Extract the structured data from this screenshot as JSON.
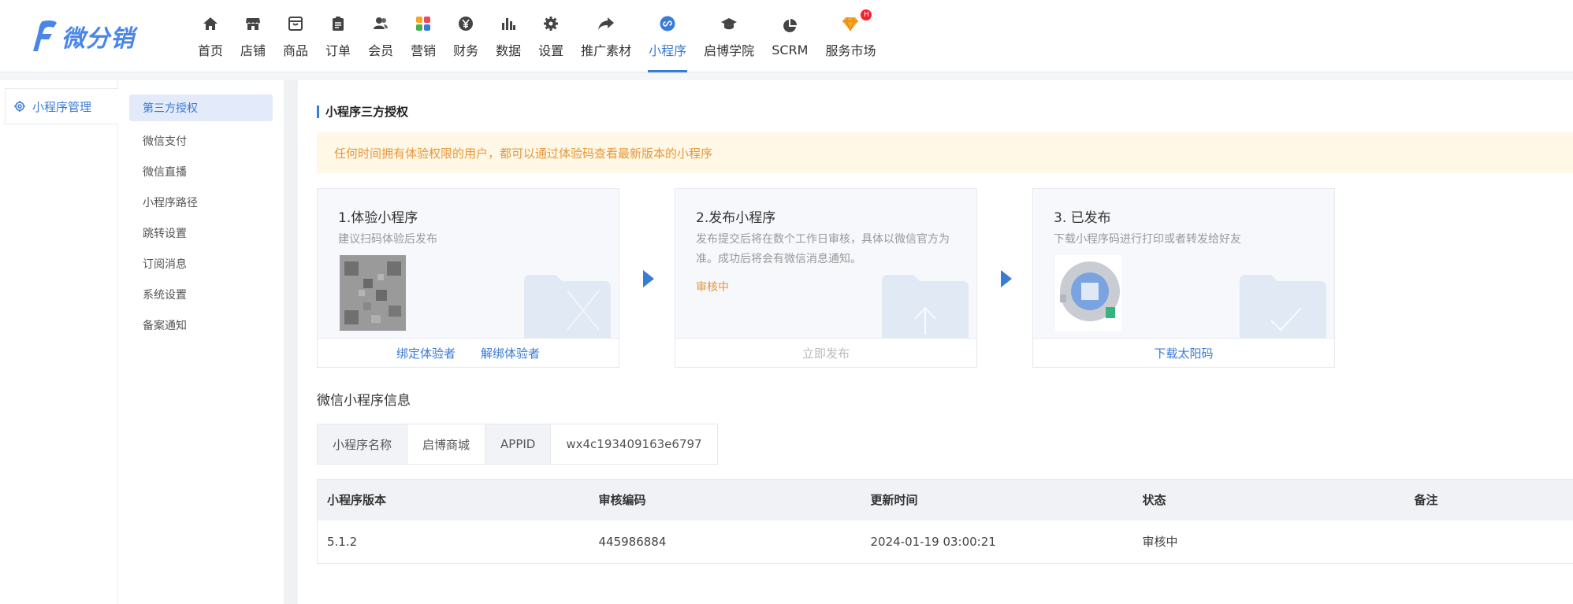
{
  "app": {
    "logo_text": "微分销"
  },
  "nav": [
    {
      "label": "首页",
      "icon": "home-icon"
    },
    {
      "label": "店铺",
      "icon": "store-icon"
    },
    {
      "label": "商品",
      "icon": "box-icon"
    },
    {
      "label": "订单",
      "icon": "clipboard-icon"
    },
    {
      "label": "会员",
      "icon": "users-icon"
    },
    {
      "label": "营销",
      "icon": "grid-color-icon"
    },
    {
      "label": "财务",
      "icon": "yen-icon"
    },
    {
      "label": "数据",
      "icon": "bar-chart-icon"
    },
    {
      "label": "设置",
      "icon": "gear-icon"
    },
    {
      "label": "推广素材",
      "icon": "share-arrow-icon"
    },
    {
      "label": "小程序",
      "icon": "link-icon"
    },
    {
      "label": "启博学院",
      "icon": "graduation-cap-icon"
    },
    {
      "label": "SCRM",
      "icon": "pie-chart-icon"
    },
    {
      "label": "服务市场",
      "icon": "diamond-icon",
      "badge": "H"
    }
  ],
  "active_nav": "小程序",
  "sidebar_primary": {
    "label": "小程序管理"
  },
  "sidebar_secondary": [
    "第三方授权",
    "微信支付",
    "微信直播",
    "小程序路径",
    "跳转设置",
    "订阅消息",
    "系统设置",
    "备案通知"
  ],
  "main": {
    "title": "小程序三方授权",
    "notice": "任何时间拥有体验权限的用户，都可以通过体验码查看最新版本的小程序",
    "steps": [
      {
        "title": "1.体验小程序",
        "desc": "建议扫码体验后发布",
        "actions": [
          "绑定体验者",
          "解绑体验者"
        ]
      },
      {
        "title": "2.发布小程序",
        "desc": "发布提交后将在数个工作日审核，具体以微信官方为准。成功后将会有微信消息通知。",
        "status": "审核中",
        "actions": [
          "立即发布"
        ]
      },
      {
        "title": "3. 已发布",
        "desc": "下载小程序码进行打印或者转发给好友",
        "actions": [
          "下载太阳码"
        ]
      }
    ],
    "info_title": "微信小程序信息",
    "info": {
      "name_label": "小程序名称",
      "name_value": "启博商城",
      "appid_label": "APPID",
      "appid_value": "wx4c193409163e6797"
    },
    "table": {
      "headers": [
        "小程序版本",
        "审核编码",
        "更新时间",
        "状态",
        "备注"
      ],
      "rows": [
        [
          "5.1.2",
          "445986884",
          "2024-01-19 03:00:21",
          "审核中",
          ""
        ]
      ]
    }
  },
  "colors": {
    "accent": "#3a7bd5",
    "warning": "#e6963a"
  }
}
